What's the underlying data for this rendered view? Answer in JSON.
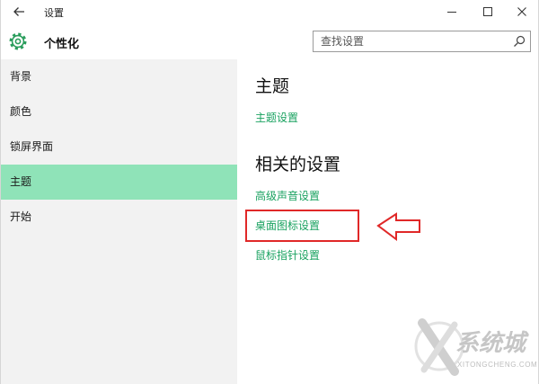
{
  "window": {
    "title": "设置",
    "icons": {
      "back": "back-arrow-icon",
      "minimize": "minimize-icon",
      "maximize": "maximize-icon",
      "close": "close-icon"
    }
  },
  "header": {
    "icon": "gear-icon",
    "section_title": "个性化",
    "search": {
      "placeholder": "查找设置",
      "value": "",
      "icon": "search-icon"
    }
  },
  "sidebar": {
    "items": [
      {
        "label": "背景",
        "selected": false
      },
      {
        "label": "颜色",
        "selected": false
      },
      {
        "label": "锁屏界面",
        "selected": false
      },
      {
        "label": "主题",
        "selected": true
      },
      {
        "label": "开始",
        "selected": false
      }
    ]
  },
  "main": {
    "heading": "主题",
    "theme_settings_link": "主题设置",
    "related_heading": "相关的设置",
    "related_links": [
      {
        "label": "高级声音设置",
        "highlighted": false
      },
      {
        "label": "桌面图标设置",
        "highlighted": true
      },
      {
        "label": "鼠标指针设置",
        "highlighted": false
      }
    ]
  },
  "annotation": {
    "icon": "red-left-arrow-icon"
  },
  "watermark": {
    "brand": "系统城",
    "url": "XITONGCHENG.COM",
    "icon": "xitongcheng-logo-icon"
  },
  "colors": {
    "accent": "#1aa260",
    "selected_bg": "#8fe3b8",
    "sidebar_bg": "#f2f2f2",
    "highlight": "#e02828"
  }
}
